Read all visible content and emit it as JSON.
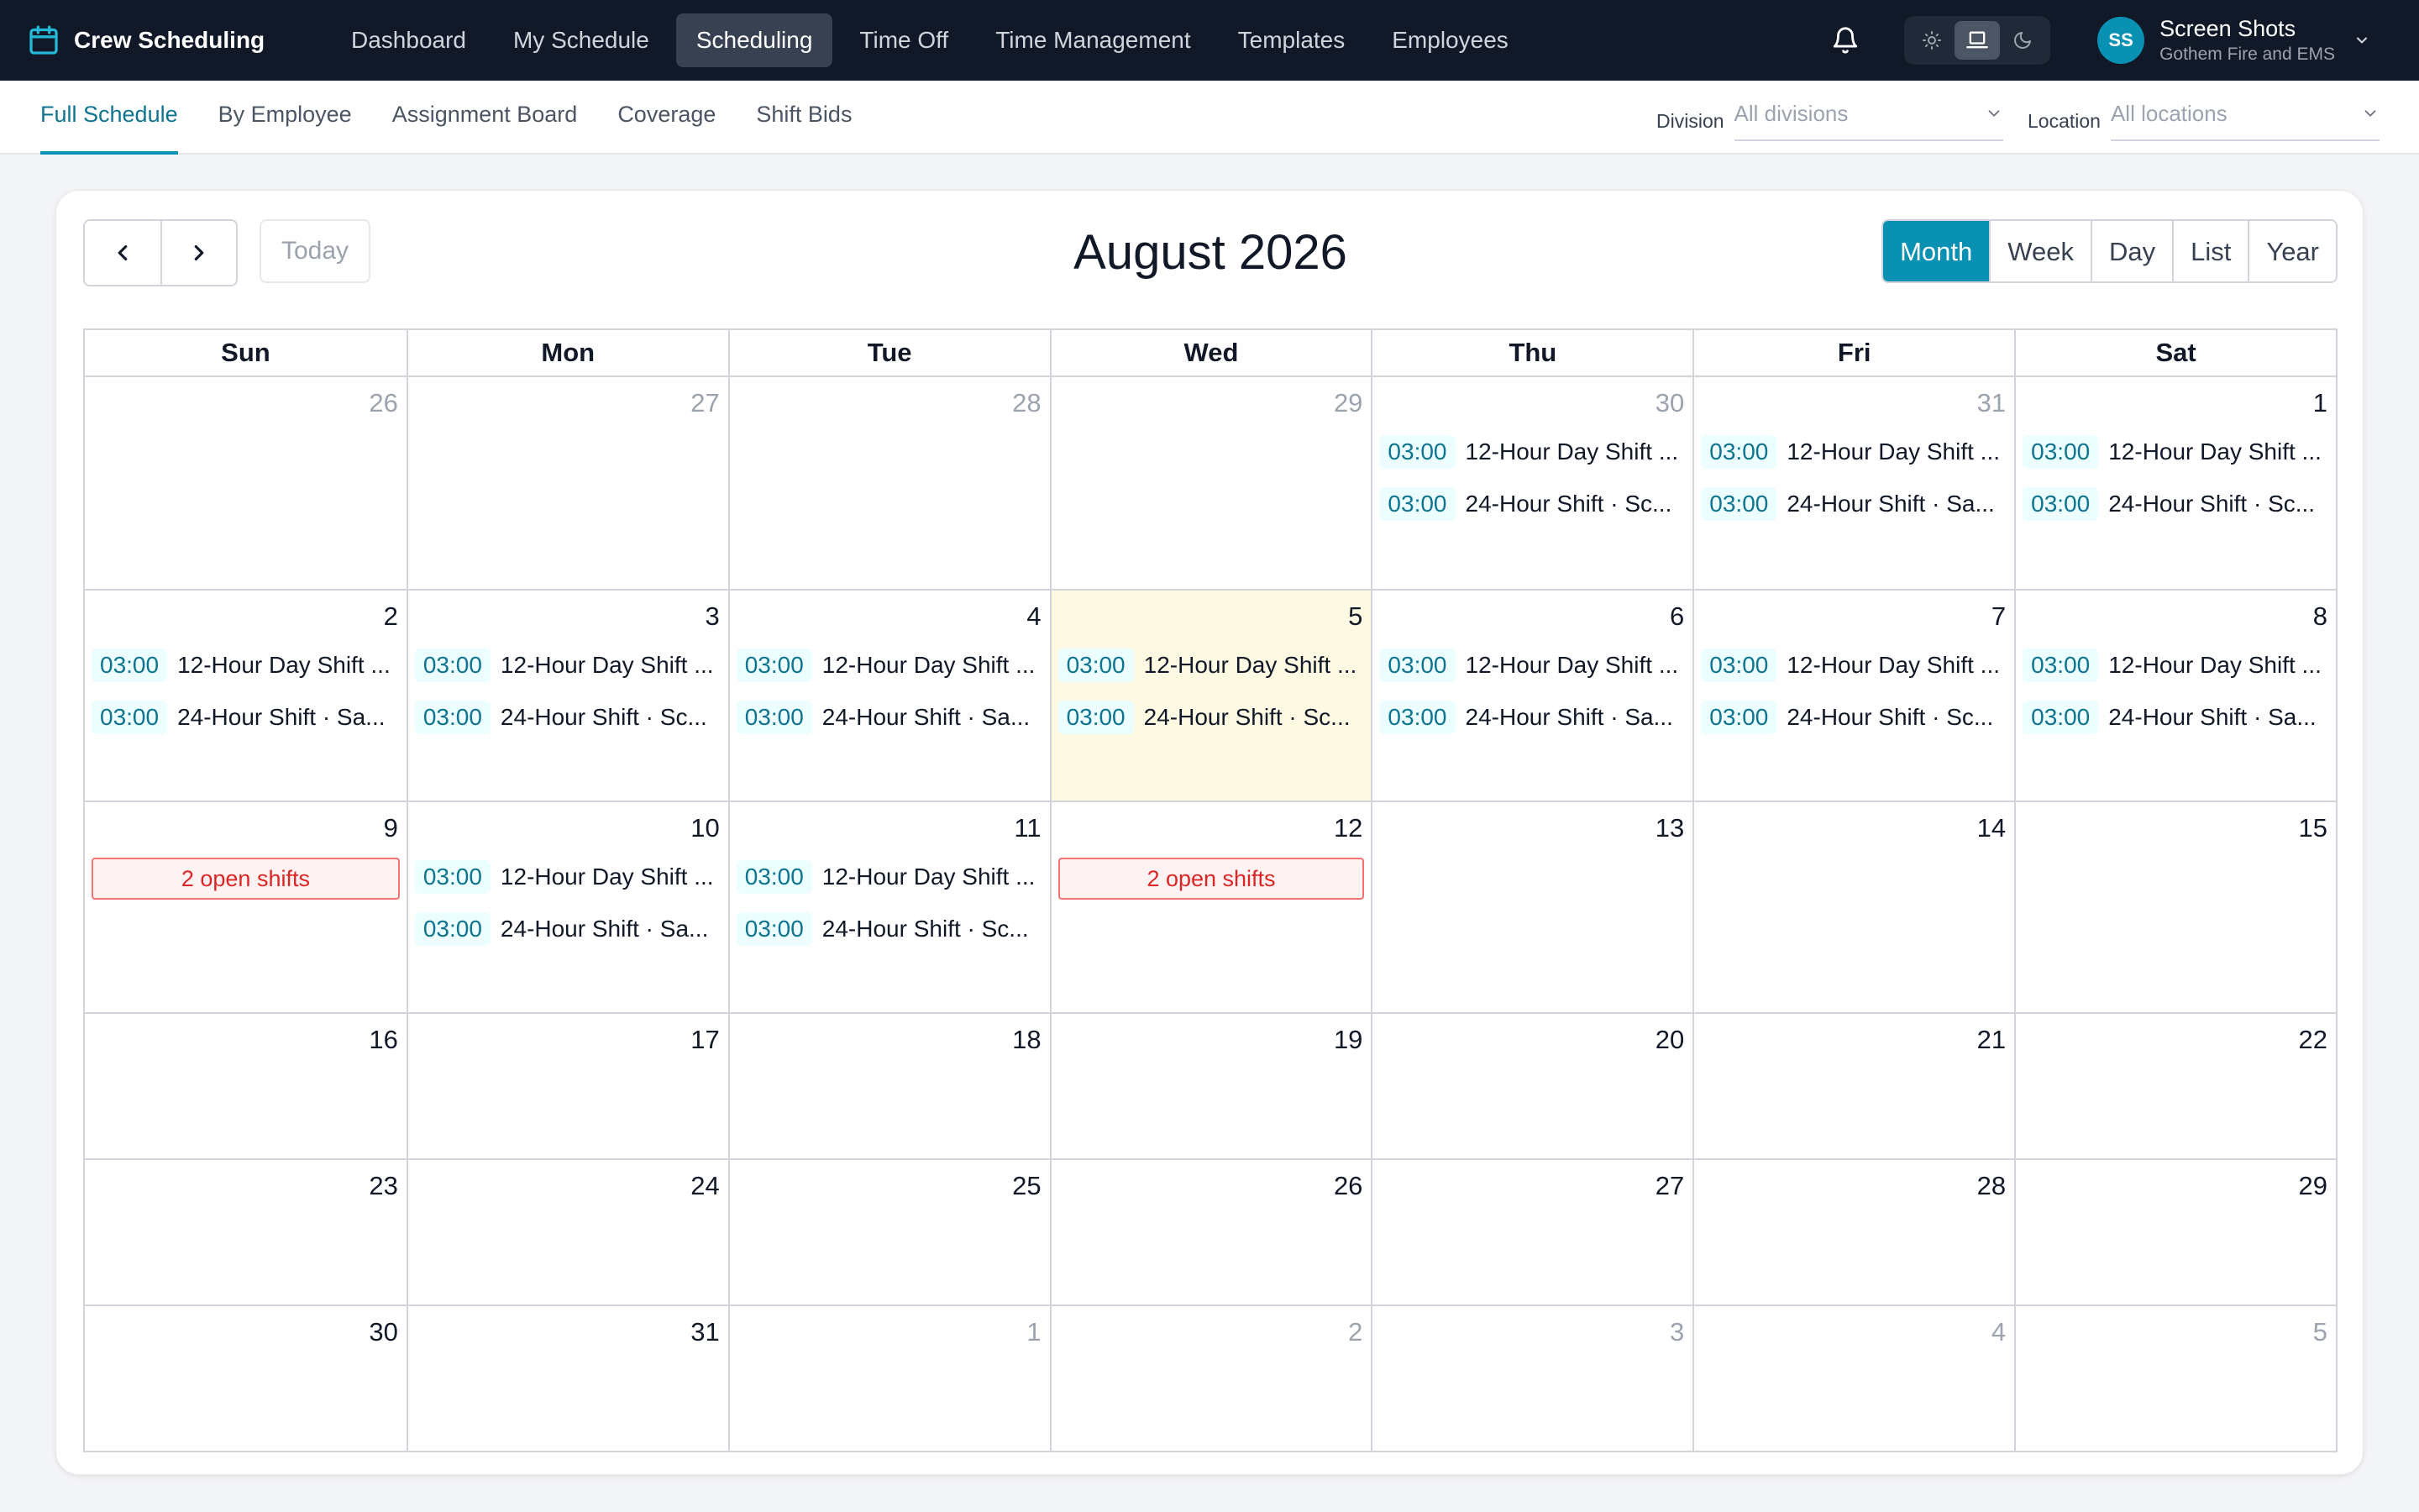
{
  "app": {
    "name": "Crew Scheduling"
  },
  "nav": {
    "items": [
      {
        "label": "Dashboard"
      },
      {
        "label": "My Schedule"
      },
      {
        "label": "Scheduling",
        "active": true
      },
      {
        "label": "Time Off"
      },
      {
        "label": "Time Management"
      },
      {
        "label": "Templates"
      },
      {
        "label": "Employees"
      }
    ]
  },
  "user": {
    "initials": "SS",
    "name": "Screen Shots",
    "org": "Gothem Fire and EMS"
  },
  "subnav": {
    "tabs": [
      {
        "label": "Full Schedule",
        "active": true
      },
      {
        "label": "By Employee"
      },
      {
        "label": "Assignment Board"
      },
      {
        "label": "Coverage"
      },
      {
        "label": "Shift Bids"
      }
    ]
  },
  "filters": {
    "division": {
      "label": "Division",
      "placeholder": "All divisions"
    },
    "location": {
      "label": "Location",
      "placeholder": "All locations"
    }
  },
  "toolbar": {
    "today_label": "Today",
    "title": "August 2026",
    "views": [
      {
        "label": "Month",
        "active": true
      },
      {
        "label": "Week"
      },
      {
        "label": "Day"
      },
      {
        "label": "List"
      },
      {
        "label": "Year"
      }
    ]
  },
  "calendar": {
    "weekdays": [
      "Sun",
      "Mon",
      "Tue",
      "Wed",
      "Thu",
      "Fri",
      "Sat"
    ],
    "weeks": [
      [
        {
          "day": "26",
          "muted": true,
          "events": []
        },
        {
          "day": "27",
          "muted": true,
          "events": []
        },
        {
          "day": "28",
          "muted": true,
          "events": []
        },
        {
          "day": "29",
          "muted": true,
          "events": []
        },
        {
          "day": "30",
          "muted": true,
          "events": [
            {
              "time": "03:00",
              "title": "12-Hour Day Shift ..."
            },
            {
              "time": "03:00",
              "title": "24-Hour Shift · Sc..."
            }
          ]
        },
        {
          "day": "31",
          "muted": true,
          "events": [
            {
              "time": "03:00",
              "title": "12-Hour Day Shift ..."
            },
            {
              "time": "03:00",
              "title": "24-Hour Shift · Sa..."
            }
          ]
        },
        {
          "day": "1",
          "events": [
            {
              "time": "03:00",
              "title": "12-Hour Day Shift ..."
            },
            {
              "time": "03:00",
              "title": "24-Hour Shift · Sc..."
            }
          ]
        }
      ],
      [
        {
          "day": "2",
          "events": [
            {
              "time": "03:00",
              "title": "12-Hour Day Shift ..."
            },
            {
              "time": "03:00",
              "title": "24-Hour Shift · Sa..."
            }
          ]
        },
        {
          "day": "3",
          "events": [
            {
              "time": "03:00",
              "title": "12-Hour Day Shift ..."
            },
            {
              "time": "03:00",
              "title": "24-Hour Shift · Sc..."
            }
          ]
        },
        {
          "day": "4",
          "events": [
            {
              "time": "03:00",
              "title": "12-Hour Day Shift ..."
            },
            {
              "time": "03:00",
              "title": "24-Hour Shift · Sa..."
            }
          ]
        },
        {
          "day": "5",
          "today": true,
          "events": [
            {
              "time": "03:00",
              "title": "12-Hour Day Shift ..."
            },
            {
              "time": "03:00",
              "title": "24-Hour Shift · Sc..."
            }
          ]
        },
        {
          "day": "6",
          "events": [
            {
              "time": "03:00",
              "title": "12-Hour Day Shift ..."
            },
            {
              "time": "03:00",
              "title": "24-Hour Shift · Sa..."
            }
          ]
        },
        {
          "day": "7",
          "events": [
            {
              "time": "03:00",
              "title": "12-Hour Day Shift ..."
            },
            {
              "time": "03:00",
              "title": "24-Hour Shift · Sc..."
            }
          ]
        },
        {
          "day": "8",
          "events": [
            {
              "time": "03:00",
              "title": "12-Hour Day Shift ..."
            },
            {
              "time": "03:00",
              "title": "24-Hour Shift · Sa..."
            }
          ]
        }
      ],
      [
        {
          "day": "9",
          "open": "2 open shifts",
          "events": []
        },
        {
          "day": "10",
          "events": [
            {
              "time": "03:00",
              "title": "12-Hour Day Shift ..."
            },
            {
              "time": "03:00",
              "title": "24-Hour Shift · Sa..."
            }
          ]
        },
        {
          "day": "11",
          "events": [
            {
              "time": "03:00",
              "title": "12-Hour Day Shift ..."
            },
            {
              "time": "03:00",
              "title": "24-Hour Shift · Sc..."
            }
          ]
        },
        {
          "day": "12",
          "open": "2 open shifts",
          "events": []
        },
        {
          "day": "13",
          "events": []
        },
        {
          "day": "14",
          "events": []
        },
        {
          "day": "15",
          "events": []
        }
      ],
      [
        {
          "day": "16",
          "events": []
        },
        {
          "day": "17",
          "events": []
        },
        {
          "day": "18",
          "events": []
        },
        {
          "day": "19",
          "events": []
        },
        {
          "day": "20",
          "events": []
        },
        {
          "day": "21",
          "events": []
        },
        {
          "day": "22",
          "events": []
        }
      ],
      [
        {
          "day": "23",
          "events": []
        },
        {
          "day": "24",
          "events": []
        },
        {
          "day": "25",
          "events": []
        },
        {
          "day": "26",
          "events": []
        },
        {
          "day": "27",
          "events": []
        },
        {
          "day": "28",
          "events": []
        },
        {
          "day": "29",
          "events": []
        }
      ],
      [
        {
          "day": "30",
          "events": []
        },
        {
          "day": "31",
          "events": []
        },
        {
          "day": "1",
          "muted": true,
          "events": []
        },
        {
          "day": "2",
          "muted": true,
          "events": []
        },
        {
          "day": "3",
          "muted": true,
          "events": []
        },
        {
          "day": "4",
          "muted": true,
          "events": []
        },
        {
          "day": "5",
          "muted": true,
          "events": []
        }
      ]
    ]
  },
  "colors": {
    "accent": "#0891b2",
    "nav_bg": "#111827",
    "today_bg": "#fef9e3",
    "open_shift": "#dc2626"
  }
}
